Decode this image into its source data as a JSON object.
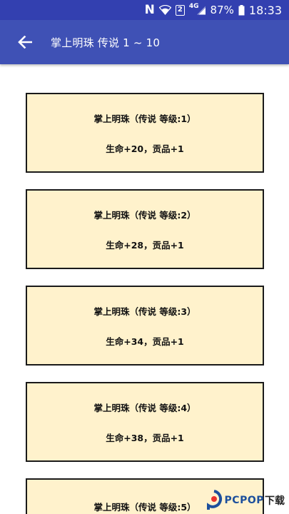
{
  "status_bar": {
    "carrier_glyph": "N",
    "sim_badge": "2",
    "network": "4G",
    "battery_percent": "87%",
    "time": "18:33"
  },
  "app_bar": {
    "title": "掌上明珠 传说 1 ~ 10",
    "back_icon": "arrow-left-icon"
  },
  "cards": [
    {
      "title": "掌上明珠（传说 等级:1）",
      "effect": "生命+20，贡品+1"
    },
    {
      "title": "掌上明珠（传说 等级:2）",
      "effect": "生命+28，贡品+1"
    },
    {
      "title": "掌上明珠（传说 等级:3）",
      "effect": "生命+34，贡品+1"
    },
    {
      "title": "掌上明珠（传说 等级:4）",
      "effect": "生命+38，贡品+1"
    },
    {
      "title": "掌上明珠（传说 等级:5）",
      "effect": ""
    }
  ],
  "watermark": {
    "brand": "PCPOP",
    "suffix": "下载"
  },
  "colors": {
    "status_bar": "#3340b0",
    "app_bar": "#3f51b5",
    "card_bg": "#fff2cc",
    "card_border": "#1a1a1a"
  }
}
